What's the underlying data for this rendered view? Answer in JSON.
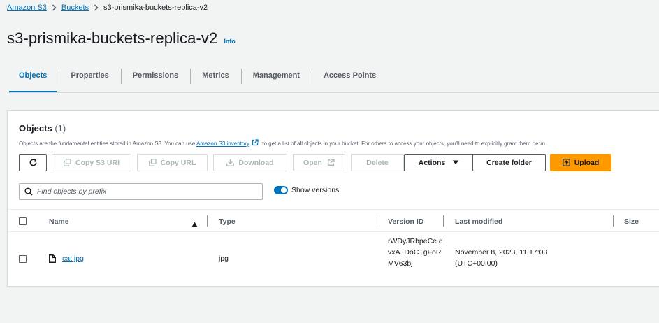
{
  "breadcrumb": {
    "items": [
      "Amazon S3",
      "Buckets"
    ],
    "current": "s3-prismika-buckets-replica-v2"
  },
  "header": {
    "title": "s3-prismika-buckets-replica-v2",
    "info_label": "Info"
  },
  "tabs": [
    "Objects",
    "Properties",
    "Permissions",
    "Metrics",
    "Management",
    "Access Points"
  ],
  "objects_panel": {
    "title": "Objects",
    "count": "(1)",
    "description_before": "Objects are the fundamental entities stored in Amazon S3. You can use",
    "description_link": "Amazon S3 inventory",
    "description_after": "to get a list of all objects in your bucket. For others to access your objects, you’ll need to explicitly grant them perm",
    "buttons": {
      "copy_s3_uri": "Copy S3 URI",
      "copy_url": "Copy URL",
      "download": "Download",
      "open": "Open",
      "delete": "Delete",
      "actions": "Actions",
      "create_folder": "Create folder",
      "upload": "Upload"
    },
    "search_placeholder": "Find objects by prefix",
    "show_versions_label": "Show versions",
    "show_versions_on": true
  },
  "table": {
    "columns": [
      "Name",
      "Type",
      "Version ID",
      "Last modified",
      "Size"
    ],
    "rows": [
      {
        "name": "cat.jpg",
        "type": "jpg",
        "version_id": "rWDyJRbpeCe.dvxA..DoCTgFoRMV63bj",
        "last_modified": "November 8, 2023, 11:17:03 (UTC+00:00)"
      }
    ]
  },
  "colors": {
    "accent": "#0073bb",
    "upload_button": "#ff9900",
    "background": "#f2f3f3"
  }
}
